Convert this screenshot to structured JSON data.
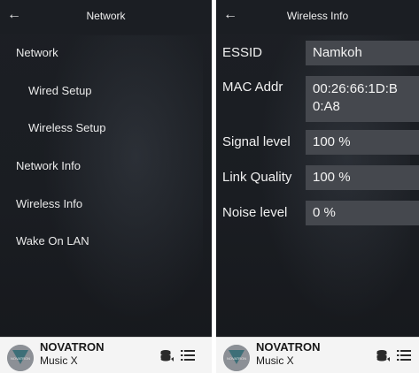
{
  "left_screen": {
    "title": "Network",
    "menu": [
      {
        "label": "Network"
      },
      {
        "label": "Wired Setup"
      },
      {
        "label": "Wireless Setup"
      },
      {
        "label": "Network Info"
      },
      {
        "label": "Wireless Info"
      },
      {
        "label": "Wake On LAN"
      }
    ]
  },
  "right_screen": {
    "title": "Wireless Info",
    "rows": [
      {
        "label": "ESSID",
        "value": "Namkoh"
      },
      {
        "label": "MAC Addr",
        "value_line1": "00:26:66:1D:B",
        "value_line2": "0:A8"
      },
      {
        "label": "Signal level",
        "value": "100 %"
      },
      {
        "label": "Link Quality",
        "value": "100 %"
      },
      {
        "label": "Noise level",
        "value": "0 %"
      }
    ]
  },
  "footer": {
    "brand": "NOVATRON",
    "model": "Music X",
    "logo_text": "NOVATRON"
  },
  "icons": {
    "back": "back-arrow-icon",
    "database": "database-speaker-icon",
    "list": "list-menu-icon"
  },
  "colors": {
    "background": "#1a1d22",
    "value_box": "#45484e",
    "footer": "#f4f4f4",
    "text": "#f0f0f0"
  }
}
